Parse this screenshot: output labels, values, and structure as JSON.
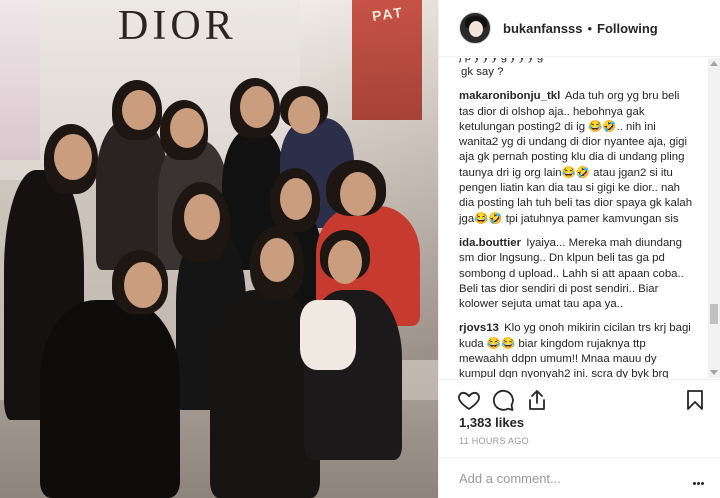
{
  "photo": {
    "brand_logo": "DIOR",
    "poster_text": "PAT"
  },
  "header": {
    "username": "bukanfansss",
    "separator": "•",
    "follow_status": "Following"
  },
  "comments": [
    {
      "username": "",
      "text": "gk say ?"
    },
    {
      "username": "makaronibonju_tkl",
      "text": "Ada tuh org yg bru beli tas dior di olshop aja.. hebohnya gak ketulungan posting2 di ig 😂🤣.. nih ini wanita2 yg di undang di dior nyantee aja, gigi aja gk pernah posting klu dia di undang pling taunya dri ig org lain😂🤣 atau jgan2 si itu pengen liatin kan dia tau si gigi ke dior.. nah dia posting lah tuh beli tas dior spaya gk kalah jga😂🤣 tpi jatuhnya pamer kamvungan sis"
    },
    {
      "username": "ida.bouttier",
      "text": "Iyaiya... Mereka mah diundang sm dior lngsung.. Dn klpun beli tas ga pd sombong d upload.. Lahh si att apaan coba.. Beli tas dior sendiri di post sendiri.. Biar kolower sejuta umat tau apa ya.."
    },
    {
      "username": "rjovs13",
      "text": "Klo yg onoh mikirin cicilan trs krj bagi kuda 😂😂 biar kingdom rujaknya ttp mewaahh ddpn umum!! Mnaa mauu dy kumpul dgn nyonyah2 ini. scra dy byk brg"
    }
  ],
  "icons": {
    "like": "heart-icon",
    "comment": "comment-icon",
    "share": "share-icon",
    "save": "bookmark-icon"
  },
  "likes": "1,383 likes",
  "time_ago": "11 HOURS AGO",
  "add_comment": {
    "placeholder": "Add a comment...",
    "value": ""
  }
}
